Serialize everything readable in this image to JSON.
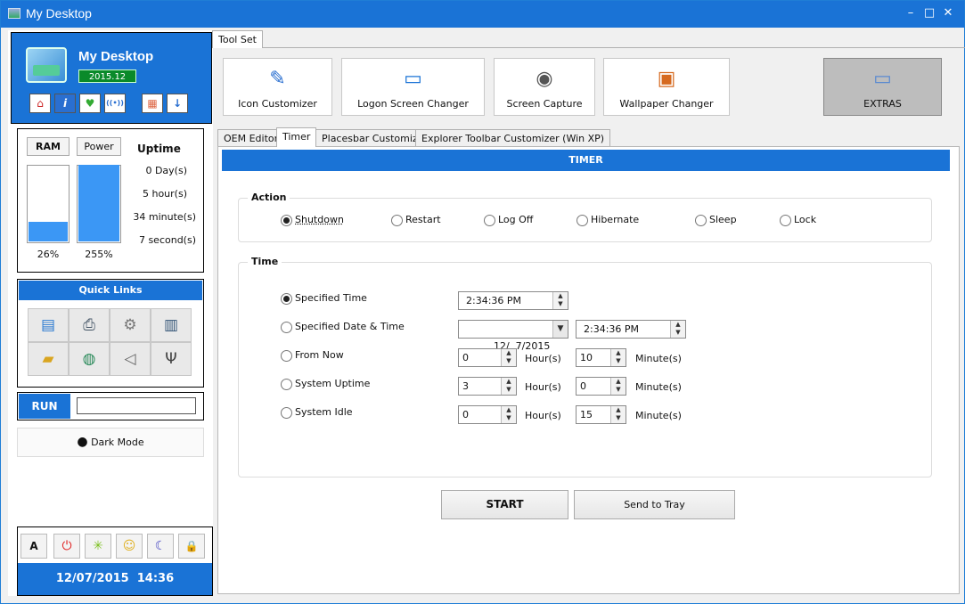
{
  "window": {
    "title": "My Desktop",
    "minimize": "–",
    "maximize": "□",
    "close": "✕"
  },
  "profile": {
    "name": "My Desktop",
    "version": "2015.12",
    "buttons": [
      {
        "icon": "home-icon",
        "glyph": "⌂"
      },
      {
        "icon": "info-icon",
        "glyph": "i"
      },
      {
        "icon": "heart-plus-icon",
        "glyph": "♥"
      },
      {
        "icon": "broadcast-icon",
        "glyph": "((•))"
      },
      {
        "icon": "apps-icon",
        "glyph": "▦"
      },
      {
        "icon": "download-icon",
        "glyph": "↓"
      }
    ]
  },
  "stats": {
    "ram_label": "RAM",
    "power_label": "Power",
    "uptime_label": "Uptime",
    "ram_percent": 26,
    "ram_text": "26%",
    "power_percent": 100,
    "power_text": "255%",
    "uptime": [
      "0 Day(s)",
      "5 hour(s)",
      "34 minute(s)",
      "7 second(s)"
    ]
  },
  "quick_links": {
    "title": "Quick Links",
    "items": [
      "control-panel-icon",
      "network-printer-icon",
      "gears-icon",
      "system-properties-icon",
      "folder-options-icon",
      "network-globe-icon",
      "volume-icon",
      "usb-icon"
    ]
  },
  "run": {
    "label": "RUN",
    "value": ""
  },
  "dark_mode": {
    "label": "Dark Mode"
  },
  "bottom_bar": {
    "buttons": [
      {
        "icon": "font-icon",
        "glyph": "A",
        "color": "#000000"
      },
      {
        "icon": "power-icon",
        "glyph": "⏻",
        "color": "#e02020"
      },
      {
        "icon": "restart-icon",
        "glyph": "✳",
        "color": "#7cc020"
      },
      {
        "icon": "sleep-face-icon",
        "glyph": "☺",
        "color": "#e0b020"
      },
      {
        "icon": "moon-icon",
        "glyph": "☾",
        "color": "#4040c0"
      },
      {
        "icon": "lock-icon",
        "glyph": "🔒",
        "color": "#e0a010"
      }
    ],
    "datetime": "12/07/2015  14:36"
  },
  "toolset": {
    "tab": "Tool Set",
    "tools": [
      {
        "label": "Icon Customizer",
        "icon": "icon-customizer-icon",
        "glyph": "✎"
      },
      {
        "label": "Logon Screen Changer",
        "icon": "monitor-icon",
        "glyph": "▭"
      },
      {
        "label": "Screen Capture",
        "icon": "camera-icon",
        "glyph": "◉"
      },
      {
        "label": "Wallpaper Changer",
        "icon": "wallpaper-icon",
        "glyph": "▣"
      },
      {
        "label": "EXTRAS",
        "icon": "window-icon",
        "glyph": "▭"
      }
    ]
  },
  "subtabs": [
    "OEM Editor",
    "Timer",
    "Placesbar Customizer",
    "Explorer Toolbar Customizer (Win XP)"
  ],
  "timer": {
    "header": "TIMER",
    "action": {
      "title": "Action",
      "options": [
        "Shutdown",
        "Restart",
        "Log Off",
        "Hibernate",
        "Sleep",
        "Lock"
      ],
      "selected": "Shutdown"
    },
    "time": {
      "title": "Time",
      "options": [
        "Specified Time",
        "Specified Date & Time",
        "From Now",
        "System Uptime",
        "System Idle"
      ],
      "selected": "Specified Time",
      "specified_time": "2:34:36 PM",
      "specified_date": "12/  7/2015",
      "specified_date_time": "2:34:36 PM",
      "from_now": {
        "hours": "0",
        "minutes": "10"
      },
      "system_uptime": {
        "hours": "3",
        "minutes": "0"
      },
      "system_idle": {
        "hours": "0",
        "minutes": "15"
      },
      "hour_unit": "Hour(s)",
      "minute_unit": "Minute(s)"
    },
    "start_label": "START",
    "tray_label": "Send to Tray"
  },
  "colors": {
    "accent": "#1a73d6",
    "meter": "#3b97f5",
    "version_badge": "#0a8a2a"
  }
}
